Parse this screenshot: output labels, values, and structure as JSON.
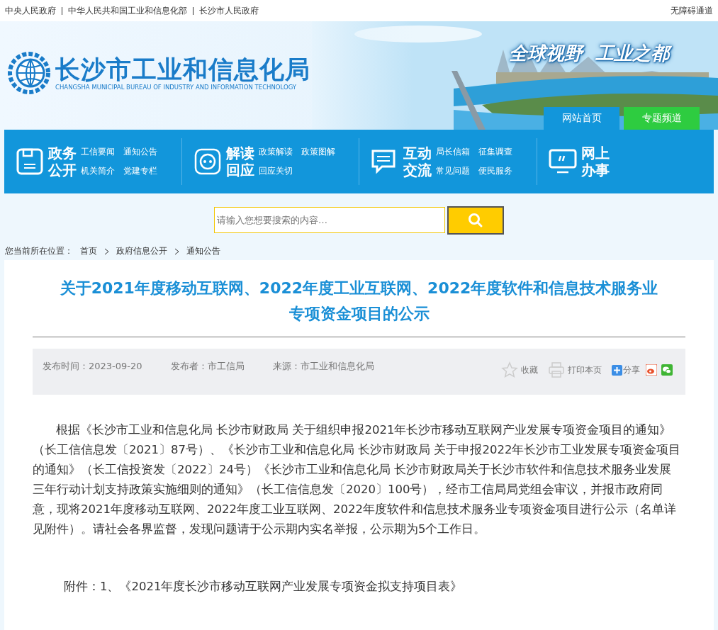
{
  "top_links": [
    "中央人民政府",
    "中华人民共和国工业和信息化部",
    "长沙市人民政府"
  ],
  "accessibility_link": "无障碍通道",
  "banner": {
    "title": "长沙市工业和信息化局",
    "subtitle": "CHANGSHA MUNICIPAL BUREAU OF INDUSTRY AND INFORMATION TECHNOLOGY",
    "slogan": "全球视野  工业之都",
    "tabs": [
      {
        "label": "网站首页",
        "color": "#1296db"
      },
      {
        "label": "专题频道",
        "color": "#2ecc40"
      }
    ]
  },
  "nav": [
    {
      "title_lines": [
        "政务",
        "公开"
      ],
      "links": [
        "工信要闻",
        "通知公告",
        "机关简介",
        "党建专栏"
      ]
    },
    {
      "title_lines": [
        "解读",
        "回应"
      ],
      "links": [
        "政策解读",
        "政策图解",
        "回应关切"
      ]
    },
    {
      "title_lines": [
        "互动",
        "交流"
      ],
      "links": [
        "局长信箱",
        "征集调查",
        "常见问题",
        "便民服务"
      ]
    },
    {
      "title_lines": [
        "网上",
        "办事"
      ]
    }
  ],
  "search": {
    "placeholder": "请输入您想要搜索的内容…"
  },
  "breadcrumb": {
    "label": "您当前所在位置：",
    "items": [
      "首页",
      "政府信息公开",
      "通知公告"
    ]
  },
  "article": {
    "title_lines": [
      "关于2021年度移动互联网、2022年度工业互联网、2022年度软件和信息技术服务业",
      "专项资金项目的公示"
    ],
    "meta": [
      "发布时间：2023-09-20",
      "发布者：市工信局",
      "来源：市工业和信息化局"
    ],
    "actions": [
      "收藏",
      "打印本页",
      "分享"
    ],
    "body": "根据《长沙市工业和信息化局 长沙市财政局 关于组织申报2021年长沙市移动互联网产业发展专项资金项目的通知》（长工信信息发〔2021〕87号）、《长沙市工业和信息化局 长沙市财政局 关于申报2022年长沙市工业发展专项资金项目的通知》（长工信投资发〔2022〕24号）《长沙市工业和信息化局 长沙市财政局关于长沙市软件和信息技术服务业发展三年行动计划支持政策实施细则的通知》（长工信信息发〔2020〕100号），经市工信局局党组会审议，并报市政府同意，现将2021年度移动互联网、2022年度工业互联网、2022年度软件和信息技术服务业专项资金项目进行公示（名单详见附件）。请社会各界监督，发现问题请于公示期内实名举报，公示期为5个工作日。",
    "attachment": "附件：1、《2021年度长沙市移动互联网产业发展专项资金拟支持项目表》"
  }
}
